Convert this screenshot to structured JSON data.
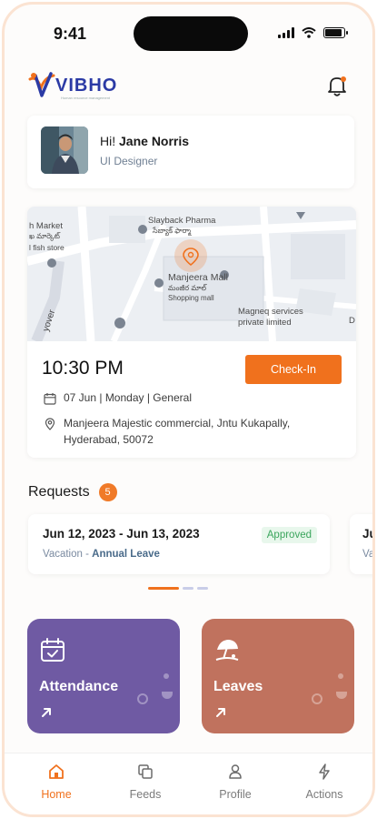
{
  "status_bar": {
    "time": "9:41"
  },
  "header": {
    "logo_text": "VIBHO",
    "logo_tagline": "Human resource management"
  },
  "profile": {
    "greeting": "Hi!",
    "name": "Jane Norris",
    "role": "UI Designer"
  },
  "map": {
    "labels": {
      "market": "h Market",
      "market_local": "ఖ మార్కెట్",
      "fish_store": "l fish store",
      "pharma": "Slayback Pharma",
      "pharma_local": "సేబ్యాక్ ఫార్మా",
      "mall": "Manjeera Mall",
      "mall_local": "మంజీర మాల్",
      "mall_type": "Shopping mall",
      "magneq_1": "Magneq services",
      "magneq_2": "private limited",
      "flyover": "yover",
      "d": "D"
    }
  },
  "attendance": {
    "time": "10:30 PM",
    "checkin_label": "Check-In",
    "date_line": "07 Jun | Monday | General",
    "address": "Manjeera Majestic commercial, Jntu Kukapally, Hyderabad, 50072"
  },
  "requests": {
    "title": "Requests",
    "count": "5",
    "items": [
      {
        "dates": "Jun 12, 2023 - Jun 13, 2023",
        "type": "Vacation",
        "separator": " - ",
        "subtype": "Annual Leave",
        "status": "Approved"
      },
      {
        "dates": "Ju",
        "type": "Va"
      }
    ]
  },
  "tiles": {
    "attendance": "Attendance",
    "leaves": "Leaves"
  },
  "nav": {
    "home": "Home",
    "feeds": "Feeds",
    "profile": "Profile",
    "actions": "Actions"
  },
  "colors": {
    "accent": "#f0711d",
    "attendance_tile": "#6f5aa3",
    "leaves_tile": "#c0725e",
    "approved_bg": "#e8f7ec",
    "approved_text": "#3aa55c",
    "logo_blue": "#2b3aa5"
  },
  "icons": [
    "bell-icon",
    "calendar-icon",
    "location-pin-icon",
    "home-icon",
    "feeds-icon",
    "profile-icon",
    "actions-icon",
    "umbrella-icon",
    "arrow-up-right-icon"
  ],
  "pager": {
    "page_count": 3,
    "active_index": 0
  },
  "battery_level": 0.9
}
